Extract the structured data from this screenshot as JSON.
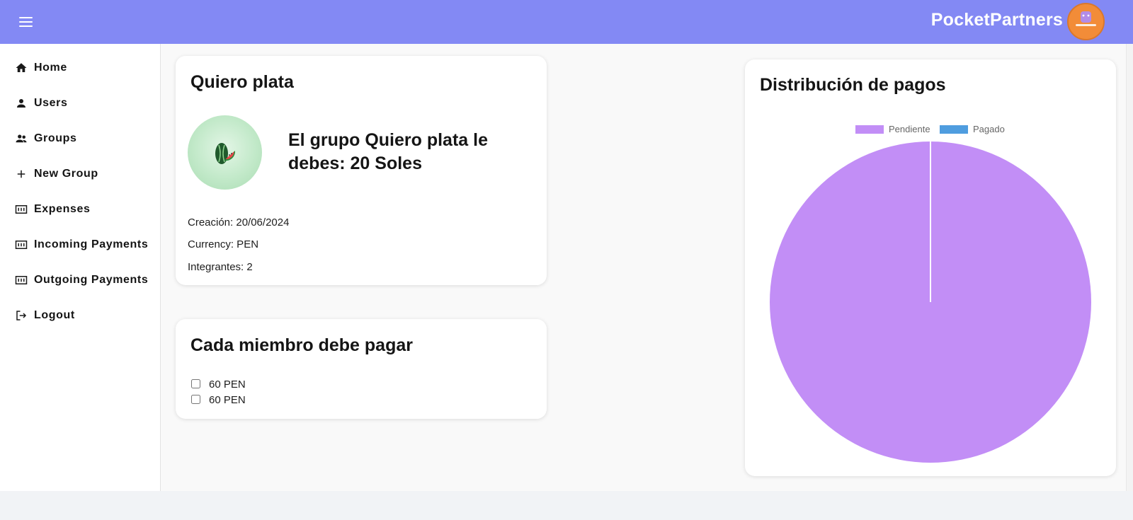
{
  "app": {
    "brand": "PocketPartners",
    "menu_icon": "hamburger-menu-icon",
    "accent_color": "#8389f4"
  },
  "sidebar": {
    "items": [
      {
        "label": "Home",
        "icon": "home-icon"
      },
      {
        "label": "Users",
        "icon": "user-icon"
      },
      {
        "label": "Groups",
        "icon": "groups-icon"
      },
      {
        "label": "New Group",
        "icon": "plus-icon"
      },
      {
        "label": "Expenses",
        "icon": "receipt-icon"
      },
      {
        "label": "Incoming Payments",
        "icon": "receipt-icon"
      },
      {
        "label": "Outgoing Payments",
        "icon": "receipt-icon"
      },
      {
        "label": "Logout",
        "icon": "logout-icon"
      }
    ]
  },
  "group": {
    "title": "Quiero plata",
    "debt_text": "El grupo Quiero plata le debes: 20 Soles",
    "creation": "Creación: 20/06/2024",
    "currency": "Currency: PEN",
    "members_count": "Integrantes: 2"
  },
  "members": {
    "title": "Cada miembro debe pagar",
    "rows": [
      {
        "amount": "60 PEN",
        "checked": false
      },
      {
        "amount": "60 PEN",
        "checked": false
      }
    ]
  },
  "chart": {
    "title": "Distribución de pagos"
  },
  "chart_data": {
    "type": "pie",
    "title": "Distribución de pagos",
    "categories": [
      "Pendiente",
      "Pagado"
    ],
    "values": [
      100,
      0
    ],
    "colors": [
      "#c28ef6",
      "#4f9ddf"
    ],
    "legend_position": "top"
  }
}
